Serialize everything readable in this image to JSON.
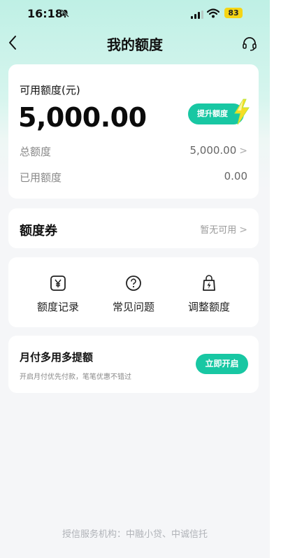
{
  "status_bar": {
    "time": "16:18",
    "battery": "83"
  },
  "nav": {
    "title": "我的额度"
  },
  "quota": {
    "label": "可用额度(元)",
    "amount": "5,000.00",
    "boost_button": "提升额度",
    "total_label": "总额度",
    "total_value": "5,000.00",
    "used_label": "已用额度",
    "used_value": "0.00"
  },
  "coupon": {
    "title": "额度券",
    "status": "暂无可用"
  },
  "menu": [
    {
      "label": "额度记录",
      "icon": "yuan-icon"
    },
    {
      "label": "常见问题",
      "icon": "question-icon"
    },
    {
      "label": "调整额度",
      "icon": "bolt-bag-icon"
    }
  ],
  "promo": {
    "title": "月付多用多提额",
    "subtitle": "开启月付优先付款，笔笔优惠不错过",
    "button": "立即开启"
  },
  "footer": {
    "text": "授信服务机构：中融小贷、中诚信托"
  },
  "colors": {
    "accent": "#18c7a3",
    "background": "#f5f6f8",
    "header_tint": "#bff0e5"
  }
}
